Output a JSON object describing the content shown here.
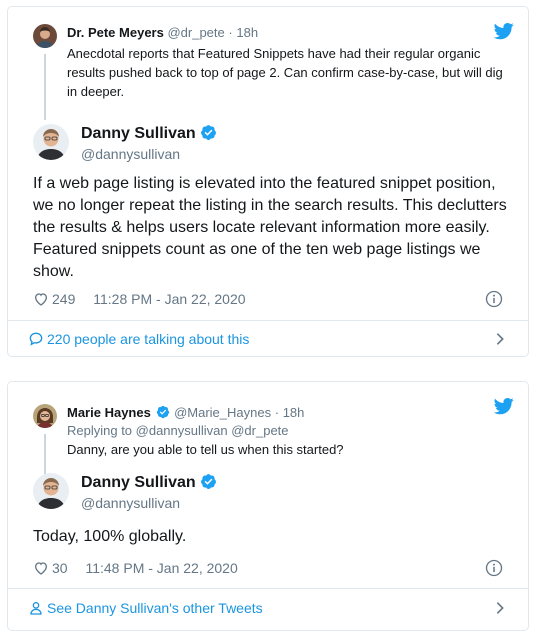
{
  "colors": {
    "accent": "#1b95e0",
    "text": "#14171a",
    "muted": "#657786",
    "border": "#e1e8ed",
    "heart": "#657786"
  },
  "tweet1": {
    "parent": {
      "name": "Dr. Pete Meyers",
      "handle": "@dr_pete",
      "dot": "·",
      "time": "18h",
      "text": "Anecdotal reports that Featured Snippets have had their regular organic results pushed back to top of page 2. Can confirm case-by-case, but will dig in deeper."
    },
    "author": {
      "name": "Danny Sullivan",
      "handle": "@dannysullivan"
    },
    "text": "If a web page listing is elevated into the featured snippet position, we no longer repeat the listing in the search results. This declutters the results & helps users locate relevant information more easily. Featured snippets count as one of the ten web page listings we show.",
    "likes": "249",
    "timestamp": "11:28 PM - Jan 22, 2020",
    "footer": "220 people are talking about this",
    "footer_icon": "comment-icon"
  },
  "tweet2": {
    "parent": {
      "name": "Marie Haynes",
      "handle": "@Marie_Haynes",
      "dot": "·",
      "time": "18h",
      "replying": "Replying to @dannysullivan @dr_pete",
      "text": "Danny, are you able to tell us when this started?"
    },
    "author": {
      "name": "Danny Sullivan",
      "handle": "@dannysullivan"
    },
    "text": "Today, 100% globally.",
    "likes": "30",
    "timestamp": "11:48 PM - Jan 22, 2020",
    "footer": "See Danny Sullivan's other Tweets",
    "footer_icon": "person-icon"
  }
}
